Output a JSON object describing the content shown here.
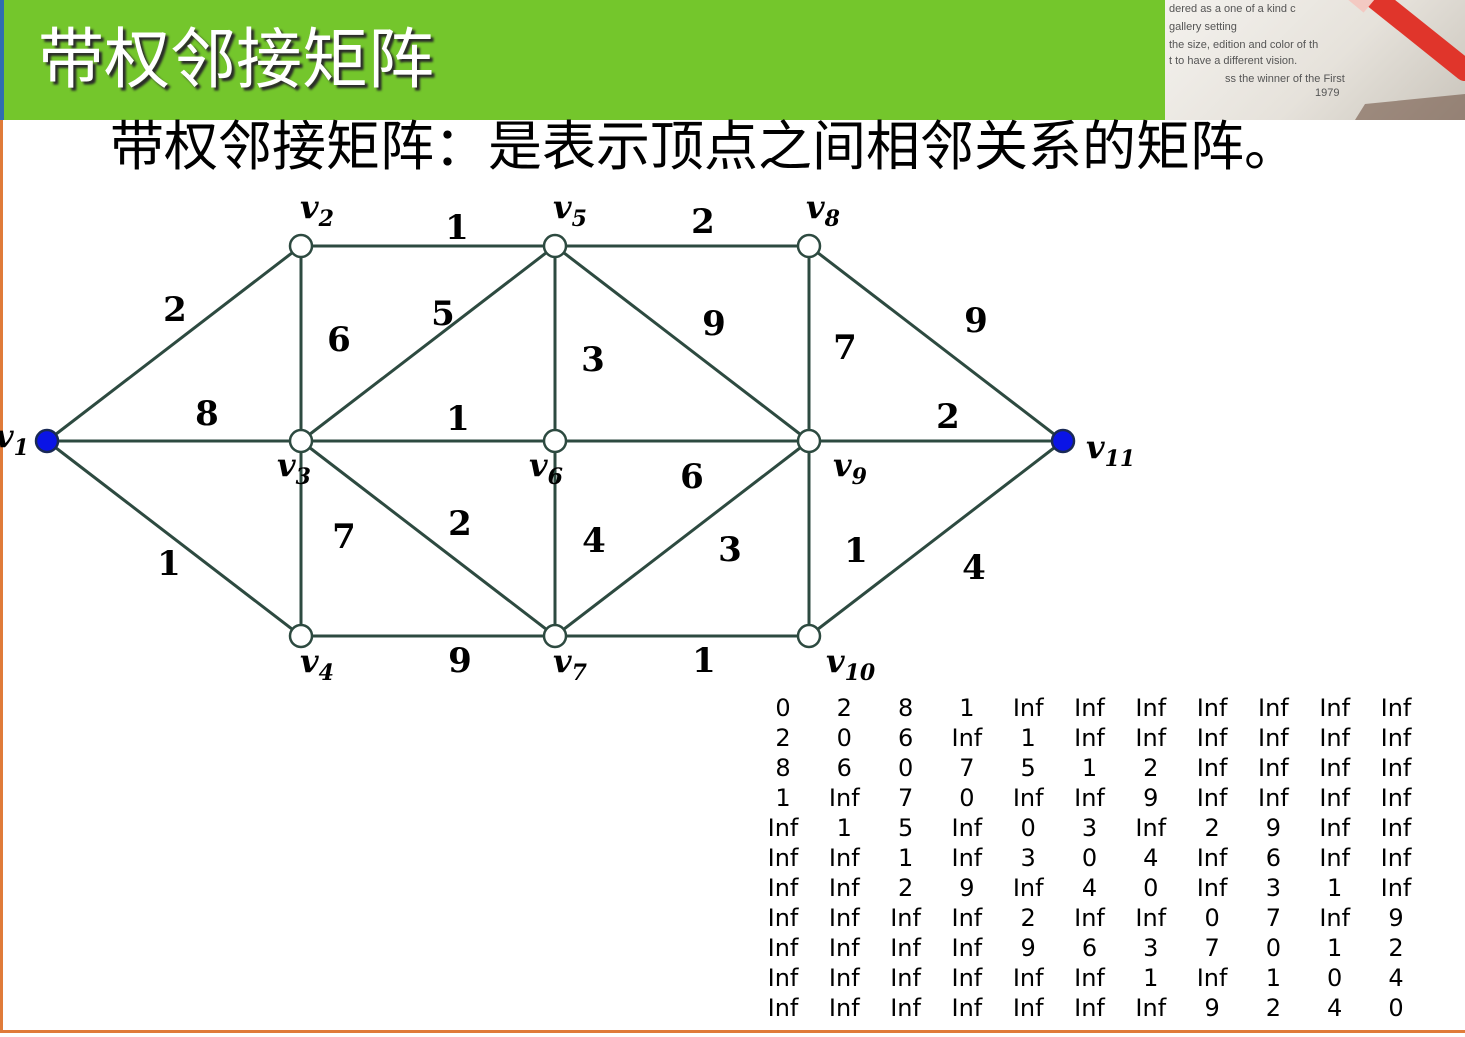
{
  "header": {
    "title": "带权邻接矩阵",
    "photo_text": [
      "dered as  a one of a kind c",
      "gallery setting",
      "the size, edition and color of th",
      "t to have a different vision.",
      "ss the winner of the First",
      "1979"
    ]
  },
  "subtitle": "带权邻接矩阵：是表示顶点之间相邻关系的矩阵。",
  "colors": {
    "header_green": "#74c62c",
    "edge": "#2d4a40",
    "highlight_vertex": "#0a14e6",
    "border": "#e07b39"
  },
  "graph": {
    "vertices": [
      {
        "id": "v1",
        "base": "v",
        "sub": "1",
        "style": "filled"
      },
      {
        "id": "v2",
        "base": "v",
        "sub": "2",
        "style": "open"
      },
      {
        "id": "v3",
        "base": "v",
        "sub": "3",
        "style": "open"
      },
      {
        "id": "v4",
        "base": "v",
        "sub": "4",
        "style": "open"
      },
      {
        "id": "v5",
        "base": "v",
        "sub": "5",
        "style": "open"
      },
      {
        "id": "v6",
        "base": "v",
        "sub": "6",
        "style": "open"
      },
      {
        "id": "v7",
        "base": "v",
        "sub": "7",
        "style": "open"
      },
      {
        "id": "v8",
        "base": "v",
        "sub": "8",
        "style": "open"
      },
      {
        "id": "v9",
        "base": "v",
        "sub": "9",
        "style": "open"
      },
      {
        "id": "v10",
        "base": "v",
        "sub": "10",
        "style": "open"
      },
      {
        "id": "v11",
        "base": "v",
        "sub": "11",
        "style": "filled"
      }
    ],
    "edges": [
      {
        "from": "v1",
        "to": "v2",
        "weight": "2"
      },
      {
        "from": "v1",
        "to": "v3",
        "weight": "8"
      },
      {
        "from": "v1",
        "to": "v4",
        "weight": "1"
      },
      {
        "from": "v2",
        "to": "v5",
        "weight": "1"
      },
      {
        "from": "v2",
        "to": "v3",
        "weight": "6"
      },
      {
        "from": "v3",
        "to": "v5",
        "weight": "5"
      },
      {
        "from": "v3",
        "to": "v6",
        "weight": "1"
      },
      {
        "from": "v3",
        "to": "v4",
        "weight": "7"
      },
      {
        "from": "v3",
        "to": "v7",
        "weight": "2"
      },
      {
        "from": "v4",
        "to": "v7",
        "weight": "9"
      },
      {
        "from": "v5",
        "to": "v8",
        "weight": "2"
      },
      {
        "from": "v5",
        "to": "v6",
        "weight": "3"
      },
      {
        "from": "v5",
        "to": "v9",
        "weight": "9"
      },
      {
        "from": "v6",
        "to": "v9",
        "weight": "6"
      },
      {
        "from": "v6",
        "to": "v7",
        "weight": "4"
      },
      {
        "from": "v7",
        "to": "v9",
        "weight": "3"
      },
      {
        "from": "v7",
        "to": "v10",
        "weight": "1"
      },
      {
        "from": "v8",
        "to": "v9",
        "weight": "7"
      },
      {
        "from": "v8",
        "to": "v11",
        "weight": "9"
      },
      {
        "from": "v9",
        "to": "v11",
        "weight": "2"
      },
      {
        "from": "v9",
        "to": "v10",
        "weight": "1"
      },
      {
        "from": "v10",
        "to": "v11",
        "weight": "4"
      }
    ]
  },
  "matrix": [
    [
      "0",
      "2",
      "8",
      "1",
      "Inf",
      "Inf",
      "Inf",
      "Inf",
      "Inf",
      "Inf",
      "Inf"
    ],
    [
      "2",
      "0",
      "6",
      "Inf",
      "1",
      "Inf",
      "Inf",
      "Inf",
      "Inf",
      "Inf",
      "Inf"
    ],
    [
      "8",
      "6",
      "0",
      "7",
      "5",
      "1",
      "2",
      "Inf",
      "Inf",
      "Inf",
      "Inf"
    ],
    [
      "1",
      "Inf",
      "7",
      "0",
      "Inf",
      "Inf",
      "9",
      "Inf",
      "Inf",
      "Inf",
      "Inf"
    ],
    [
      "Inf",
      "1",
      "5",
      "Inf",
      "0",
      "3",
      "Inf",
      "2",
      "9",
      "Inf",
      "Inf"
    ],
    [
      "Inf",
      "Inf",
      "1",
      "Inf",
      "3",
      "0",
      "4",
      "Inf",
      "6",
      "Inf",
      "Inf"
    ],
    [
      "Inf",
      "Inf",
      "2",
      "9",
      "Inf",
      "4",
      "0",
      "Inf",
      "3",
      "1",
      "Inf"
    ],
    [
      "Inf",
      "Inf",
      "Inf",
      "Inf",
      "2",
      "Inf",
      "Inf",
      "0",
      "7",
      "Inf",
      "9"
    ],
    [
      "Inf",
      "Inf",
      "Inf",
      "Inf",
      "9",
      "6",
      "3",
      "7",
      "0",
      "1",
      "2"
    ],
    [
      "Inf",
      "Inf",
      "Inf",
      "Inf",
      "Inf",
      "Inf",
      "1",
      "Inf",
      "1",
      "0",
      "4"
    ],
    [
      "Inf",
      "Inf",
      "Inf",
      "Inf",
      "Inf",
      "Inf",
      "Inf",
      "9",
      "2",
      "4",
      "0"
    ]
  ]
}
